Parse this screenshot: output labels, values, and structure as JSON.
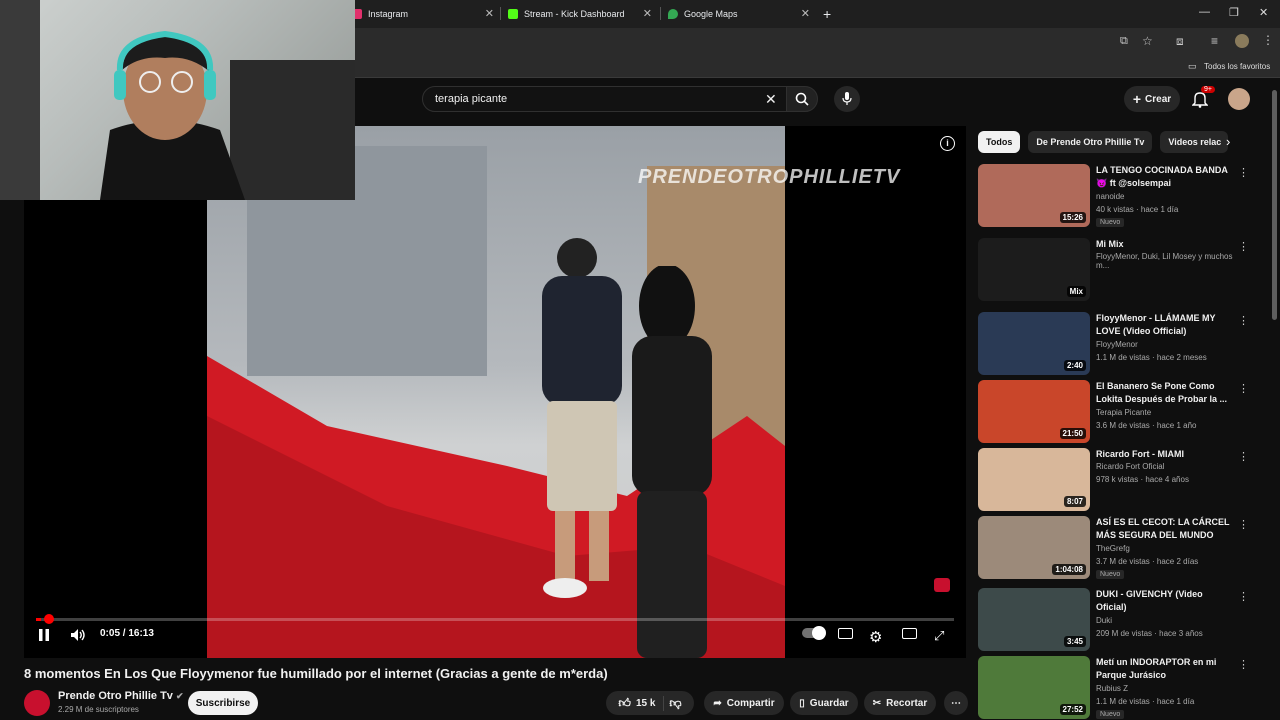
{
  "browser": {
    "tabs": [
      {
        "label": "Instagram",
        "color": "#e1306c"
      },
      {
        "label": "Stream - Kick Dashboard",
        "color": "#53fc18"
      },
      {
        "label": "Google Maps",
        "color": "#34a853"
      }
    ],
    "bookmark_folder": "Todos los favoritos"
  },
  "header": {
    "search_query": "terapia picante",
    "create_label": "Crear",
    "notif_badge": "9+"
  },
  "player": {
    "watermark": "PRENDEOTROPHILLIETV",
    "time": "0:05 / 16:13",
    "progress": 0.005
  },
  "video": {
    "title": "8 momentos En Los Que Floyymenor fue humillado por el internet (Gracias a gente de m*erda)",
    "channel": "Prende Otro Phillie Tv",
    "subscribers": "2.29 M de suscriptores",
    "subscribe_label": "Suscribirse",
    "likes": "15 k",
    "share_label": "Compartir",
    "save_label": "Guardar",
    "clip_label": "Recortar"
  },
  "sidebar": {
    "chips": [
      "Todos",
      "De Prende Otro Phillie Tv",
      "Videos relac"
    ],
    "items": [
      {
        "title": "LA TENGO COCINADA BANDA 😈 ft @solsempai",
        "channel": "nanoide",
        "meta": "40 k vistas · hace 1 día",
        "badge": "Nuevo",
        "duration": "15:26",
        "thumb": "#b06a5a"
      },
      {
        "title": "Mi Mix",
        "channel": "FloyyMenor, Duki, Lil Mosey y muchos m...",
        "meta": "",
        "badge": "",
        "duration": "Mix",
        "thumb": "#1c1c1c"
      },
      {
        "title": "FloyyMenor - LLÁMAME MY LOVE (Video Official)",
        "channel": "FloyyMenor",
        "meta": "1.1 M de vistas · hace 2 meses",
        "badge": "",
        "duration": "2:40",
        "thumb": "#2a3a55"
      },
      {
        "title": "El Bananero Se Pone Como Lokita Después de Probar la ...",
        "channel": "Terapia Picante",
        "meta": "3.6 M de vistas · hace 1 año",
        "badge": "",
        "duration": "21:50",
        "thumb": "#c9462a"
      },
      {
        "title": "Ricardo Fort - MIAMI",
        "channel": "Ricardo Fort Oficial",
        "meta": "978 k vistas · hace 4 años",
        "badge": "",
        "duration": "8:07",
        "thumb": "#d8b79a"
      },
      {
        "title": "ASÍ ES EL CECOT: LA CÁRCEL MÁS SEGURA DEL MUNDO",
        "channel": "TheGrefg",
        "meta": "3.7 M de vistas · hace 2 días",
        "badge": "Nuevo",
        "duration": "1:04:08",
        "thumb": "#9c8a7a"
      },
      {
        "title": "DUKI - GIVENCHY (Video Oficial)",
        "channel": "Duki",
        "meta": "209 M de vistas · hace 3 años",
        "badge": "",
        "duration": "3:45",
        "thumb": "#3d4a4a"
      },
      {
        "title": "Metí un INDORAPTOR en mi Parque Jurásico",
        "channel": "Rubius Z",
        "meta": "1.1 M de vistas · hace 1 día",
        "badge": "Nuevo",
        "duration": "27:52",
        "thumb": "#4f7a3a"
      }
    ]
  }
}
